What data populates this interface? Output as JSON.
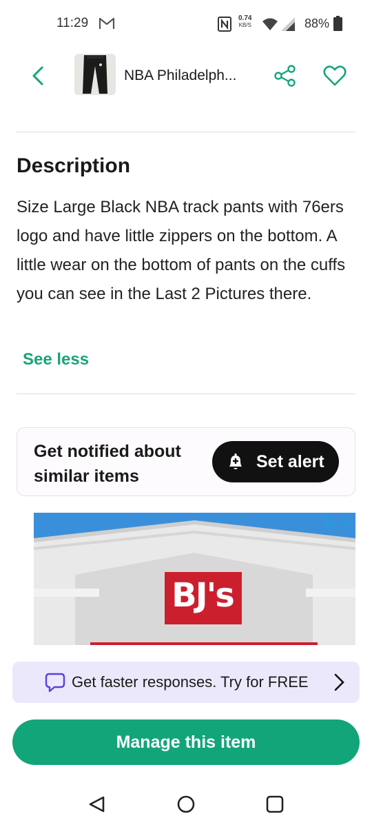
{
  "status_bar": {
    "time": "11:29",
    "speed_value": "0.74",
    "speed_unit": "KB/S",
    "battery": "88%",
    "icons": [
      "gmail-icon",
      "nfc-icon",
      "wifi-icon",
      "signal-icon",
      "battery-icon"
    ]
  },
  "header": {
    "title": "NBA Philadelph...",
    "icons": [
      "back-arrow-icon",
      "share-icon",
      "heart-icon"
    ]
  },
  "description": {
    "heading": "Description",
    "body": "Size Large Black NBA track pants with 76ers logo and have  little zippers on the bottom.   A little wear on the bottom of pants on the cuffs you can see in the Last 2 Pictures there.",
    "toggle_label": "See less"
  },
  "alert_card": {
    "text": "Get notified about similar items",
    "button_label": "Set alert"
  },
  "ad": {
    "brand_logo": "BJ's",
    "icons": [
      "adchoices-icon",
      "close-icon"
    ]
  },
  "promo": {
    "text": "Get faster responses. Try for FREE"
  },
  "manage_button": {
    "label": "Manage this item"
  },
  "colors": {
    "accent_green": "#12a57a",
    "link_green": "#1aa37a",
    "promo_bg": "#ece8fb",
    "bjs_red": "#cc1f2d"
  }
}
